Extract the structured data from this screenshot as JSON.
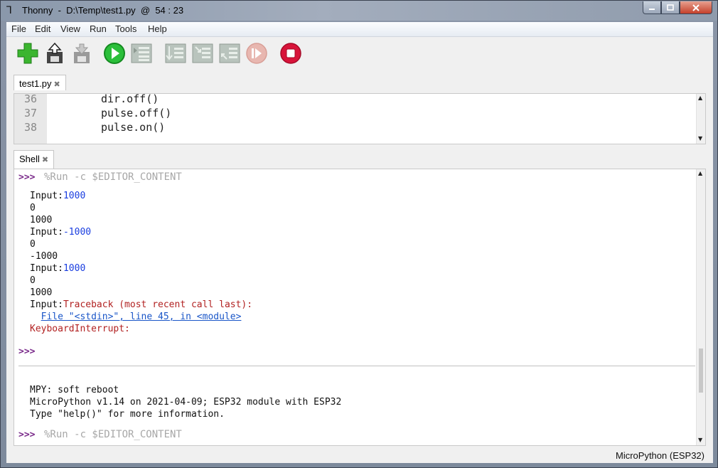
{
  "window": {
    "title": "Thonny  -  D:\\Temp\\test1.py  @  54 : 23",
    "icon": "thonny-icon",
    "controls": [
      "minimize",
      "maximize",
      "close"
    ]
  },
  "menu": [
    "File",
    "Edit",
    "View",
    "Run",
    "Tools",
    "Help"
  ],
  "toolbar": [
    {
      "name": "new-file-icon",
      "color": "#3bb52f"
    },
    {
      "name": "open-file-icon",
      "color": "#555555"
    },
    {
      "name": "save-file-icon",
      "color": "#9a9a9a"
    },
    {
      "name": "run-icon",
      "color": "#2bbf3a"
    },
    {
      "name": "debug-icon",
      "color": "#9aa6a0"
    },
    {
      "name": "step-over-icon",
      "color": "#9aa6a0"
    },
    {
      "name": "step-into-icon",
      "color": "#9aa6a0"
    },
    {
      "name": "step-out-icon",
      "color": "#9aa6a0"
    },
    {
      "name": "resume-icon",
      "color": "#e8b7b0"
    },
    {
      "name": "stop-icon",
      "color": "#d8143a"
    }
  ],
  "editor": {
    "tab_label": "test1.py",
    "lines": [
      {
        "num": "36",
        "code": "dir.off()"
      },
      {
        "num": "37",
        "code": "pulse.off()"
      },
      {
        "num": "38",
        "code": "pulse.on()"
      }
    ]
  },
  "shell": {
    "tab_label": "Shell",
    "prompt": ">>>",
    "run_command": "%Run -c $EDITOR_CONTENT",
    "output": [
      {
        "parts": [
          {
            "t": "Input:",
            "c": ""
          },
          {
            "t": "1000",
            "c": "blue"
          }
        ]
      },
      {
        "parts": [
          {
            "t": "0",
            "c": ""
          }
        ]
      },
      {
        "parts": [
          {
            "t": "1000",
            "c": ""
          }
        ]
      },
      {
        "parts": [
          {
            "t": "Input:",
            "c": ""
          },
          {
            "t": "-1000",
            "c": "blue"
          }
        ]
      },
      {
        "parts": [
          {
            "t": "0",
            "c": ""
          }
        ]
      },
      {
        "parts": [
          {
            "t": "-1000",
            "c": ""
          }
        ]
      },
      {
        "parts": [
          {
            "t": "Input:",
            "c": ""
          },
          {
            "t": "1000",
            "c": "blue"
          }
        ]
      },
      {
        "parts": [
          {
            "t": "0",
            "c": ""
          }
        ]
      },
      {
        "parts": [
          {
            "t": "1000",
            "c": ""
          }
        ]
      },
      {
        "parts": [
          {
            "t": "Input:",
            "c": ""
          },
          {
            "t": "Traceback (most recent call last):",
            "c": "red"
          }
        ]
      },
      {
        "parts": [
          {
            "t": "  ",
            "c": ""
          },
          {
            "t": "File \"<stdin>\", line 45, in <module>",
            "c": "link"
          }
        ]
      },
      {
        "parts": [
          {
            "t": "KeyboardInterrupt:",
            "c": "red"
          }
        ]
      }
    ],
    "reboot": [
      "MPY: soft reboot",
      "MicroPython v1.14 on 2021-04-09; ESP32 module with ESP32",
      "Type \"help()\" for more information."
    ]
  },
  "status": {
    "interpreter": "MicroPython (ESP32)"
  }
}
